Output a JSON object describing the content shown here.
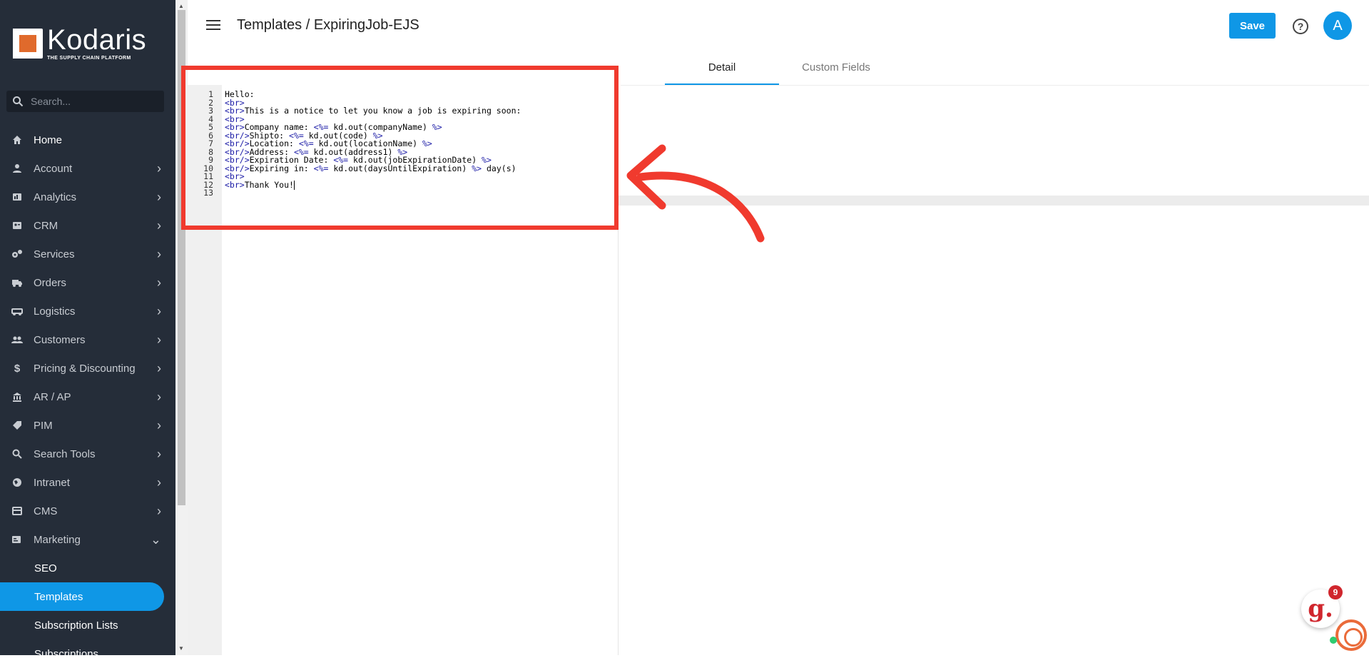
{
  "brand": {
    "name": "Kodaris",
    "tagline": "THE SUPPLY CHAIN PLATFORM",
    "accent": "#0f97e6",
    "sidebar_bg": "#252d39",
    "highlight": "#f03a2e"
  },
  "search": {
    "placeholder": "Search..."
  },
  "nav": [
    {
      "label": "Home",
      "icon": "home-icon",
      "chevron": false
    },
    {
      "label": "Account",
      "icon": "person-icon",
      "chevron": true
    },
    {
      "label": "Analytics",
      "icon": "analytics-icon",
      "chevron": true
    },
    {
      "label": "CRM",
      "icon": "crm-icon",
      "chevron": true
    },
    {
      "label": "Services",
      "icon": "gears-icon",
      "chevron": true
    },
    {
      "label": "Orders",
      "icon": "truck-icon",
      "chevron": true
    },
    {
      "label": "Logistics",
      "icon": "logistics-icon",
      "chevron": true
    },
    {
      "label": "Customers",
      "icon": "people-icon",
      "chevron": true
    },
    {
      "label": "Pricing & Discounting",
      "icon": "dollar-icon",
      "chevron": true
    },
    {
      "label": "AR / AP",
      "icon": "bank-icon",
      "chevron": true
    },
    {
      "label": "PIM",
      "icon": "tag-icon",
      "chevron": true
    },
    {
      "label": "Search Tools",
      "icon": "search-icon",
      "chevron": true
    },
    {
      "label": "Intranet",
      "icon": "intranet-icon",
      "chevron": true
    },
    {
      "label": "CMS",
      "icon": "cms-icon",
      "chevron": true
    },
    {
      "label": "Marketing",
      "icon": "marketing-icon",
      "chevron": true,
      "expanded": true
    }
  ],
  "marketing_sub": [
    {
      "label": "SEO"
    },
    {
      "label": "Templates",
      "active": true
    },
    {
      "label": "Subscription Lists"
    },
    {
      "label": "Subscriptions"
    }
  ],
  "header": {
    "breadcrumb": "Templates / ExpiringJob-EJS",
    "save_label": "Save",
    "help": "?",
    "avatar": "A"
  },
  "tabs": [
    {
      "label": "Detail",
      "active": true
    },
    {
      "label": "Custom Fields"
    }
  ],
  "editor": {
    "lines": [
      "Hello:",
      "<br>",
      "<br>This is a notice to let you know a job is expiring soon:",
      "<br>",
      "<br>Company name: <%= kd.out(companyName) %>",
      "<br/>Shipto: <%= kd.out(code) %>",
      "<br/>Location: <%= kd.out(locationName) %>",
      "<br/>Address: <%= kd.out(address1) %>",
      "<br/>Expiration Date: <%= kd.out(jobExpirationDate) %>",
      "<br/>Expiring in: <%= kd.out(daysUntilExpiration) %> day(s)",
      "<br>",
      "<br>Thank You!",
      ""
    ],
    "active_line": 12
  },
  "chat": {
    "badge": "9",
    "letter": "g."
  }
}
